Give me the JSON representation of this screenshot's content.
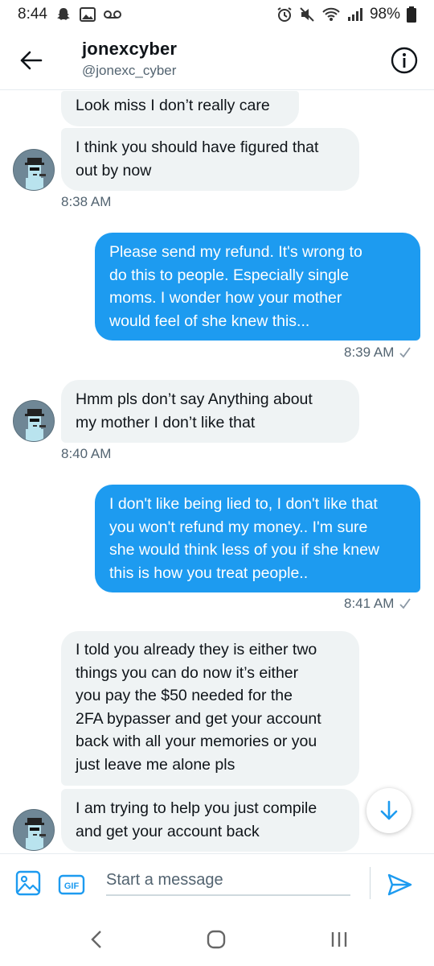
{
  "status_bar": {
    "time": "8:44",
    "battery": "98%"
  },
  "header": {
    "name": "jonexcyber",
    "handle": "@jonexc_cyber"
  },
  "messages": [
    {
      "direction": "in",
      "lines": [
        "Look miss I don’t really care"
      ]
    },
    {
      "direction": "in",
      "lines": [
        "I think you should have figured that",
        "out by now"
      ],
      "time": "8:38 AM"
    },
    {
      "direction": "out",
      "lines": [
        "Please send my refund. It's wrong to",
        "do this to people. Especially single",
        "moms. I wonder how your mother",
        "would feel of she knew this..."
      ],
      "time": "8:39 AM"
    },
    {
      "direction": "in",
      "lines": [
        "Hmm pls don’t say Anything about",
        "my mother I don’t like that"
      ],
      "time": "8:40 AM"
    },
    {
      "direction": "out",
      "lines": [
        "I don't like being lied to, I don't like that",
        "you won't refund my money.. I'm sure",
        "she would think less of you if she knew",
        "this is how you treat people.."
      ],
      "time": "8:41 AM"
    },
    {
      "direction": "in",
      "lines": [
        "I told you already they is either two",
        "things you can do now it’s either",
        "you pay the $50 needed for the",
        "2FA bypasser and get your account",
        "back with all your memories or you",
        "just leave me alone pls"
      ]
    },
    {
      "direction": "in",
      "lines": [
        "I am trying to help you just compile",
        "and get your account back"
      ]
    }
  ],
  "composer": {
    "placeholder": "Start a message",
    "gif_label": "GIF"
  },
  "colors": {
    "accent": "#1d9bf0",
    "incoming_bubble": "#eff3f4"
  }
}
